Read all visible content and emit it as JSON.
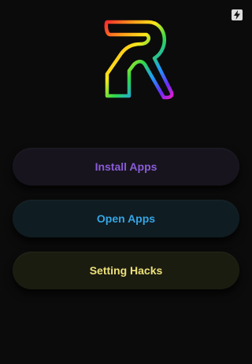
{
  "status": {
    "icon": "lightning-battery-icon"
  },
  "logo": {
    "icon": "rainbow-r-logo",
    "letter": "R"
  },
  "menu": {
    "install_label": "Install Apps",
    "open_label": "Open Apps",
    "hacks_label": "Setting Hacks"
  },
  "colors": {
    "background": "#0b0b0b",
    "install_text": "#8a5cd8",
    "install_bg": "#17141d",
    "open_text": "#35a6e5",
    "open_bg": "#0f1c22",
    "hacks_text": "#ece07a",
    "hacks_bg": "#1b1c10"
  }
}
